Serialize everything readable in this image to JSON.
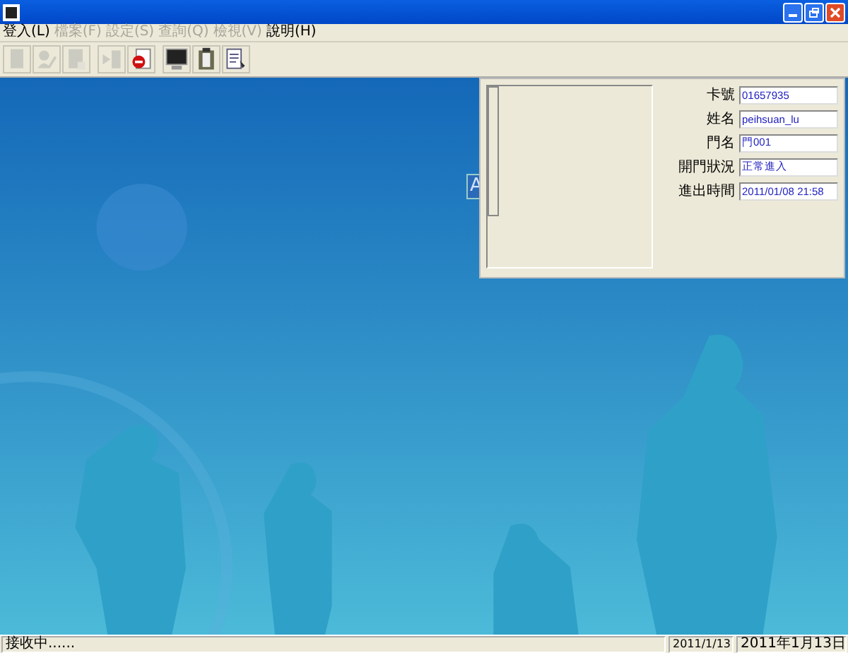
{
  "menu": [
    {
      "label": "登入(L)",
      "disabled": false
    },
    {
      "label": "檔案(F)",
      "disabled": true
    },
    {
      "label": "設定(S)",
      "disabled": true
    },
    {
      "label": "查詢(Q)",
      "disabled": true
    },
    {
      "label": "檢視(V)",
      "disabled": true
    },
    {
      "label": "說明(H)",
      "disabled": false
    }
  ],
  "toolbar": [
    {
      "kind": "page",
      "disabled": true
    },
    {
      "kind": "user-edit",
      "disabled": true
    },
    {
      "kind": "doc",
      "disabled": true
    },
    {
      "kind": "play",
      "disabled": true
    },
    {
      "kind": "stop",
      "disabled": false
    },
    {
      "kind": "monitor",
      "disabled": false
    },
    {
      "kind": "clipboard",
      "disabled": false
    },
    {
      "kind": "report",
      "disabled": false
    }
  ],
  "backdrop": {
    "logo_fragment": "A"
  },
  "record_panel": {
    "fields": [
      {
        "label": "卡號",
        "value": "01657935"
      },
      {
        "label": "姓名",
        "value": "peihsuan_lu"
      },
      {
        "label": "門名",
        "value": "門001"
      },
      {
        "label": "開門狀況",
        "value": "正常進入"
      },
      {
        "label": "進出時間",
        "value": "2011/01/08 21:58"
      }
    ]
  },
  "status_bar": {
    "message": "接收中......",
    "date": "2011/1/13",
    "clock": "2011年1月13日"
  }
}
